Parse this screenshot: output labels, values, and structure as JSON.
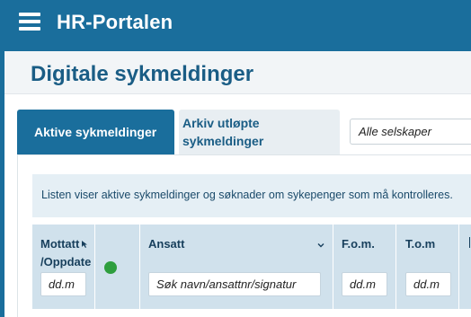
{
  "app": {
    "title": "HR-Portalen"
  },
  "page": {
    "title": "Digitale sykmeldinger"
  },
  "tabs": [
    {
      "label": "Aktive sykmeldinger",
      "active": true
    },
    {
      "label": "Arkiv utløpte sykmeldinger",
      "active": false
    }
  ],
  "company_select": {
    "value": "Alle selskaper"
  },
  "info": {
    "text": "Listen viser aktive sykmeldinger og søknader om sykepenger som må kontrolleres."
  },
  "table": {
    "columns": [
      {
        "label": "Mottatt /Oppdate",
        "filter_placeholder": "dd.m"
      },
      {
        "label": "",
        "filter_placeholder": ""
      },
      {
        "label": "Ansatt",
        "filter_placeholder": "Søk navn/ansattnr/signatur"
      },
      {
        "label": "F.o.m.",
        "filter_placeholder": "dd.m"
      },
      {
        "label": "T.o.m",
        "filter_placeholder": "dd.m"
      }
    ]
  },
  "colors": {
    "brand": "#1a6e9c",
    "title": "#1a5d85",
    "header_row": "#d0e1ec",
    "info_bar": "#e5eff5",
    "status_ok": "#2e9e3e"
  }
}
